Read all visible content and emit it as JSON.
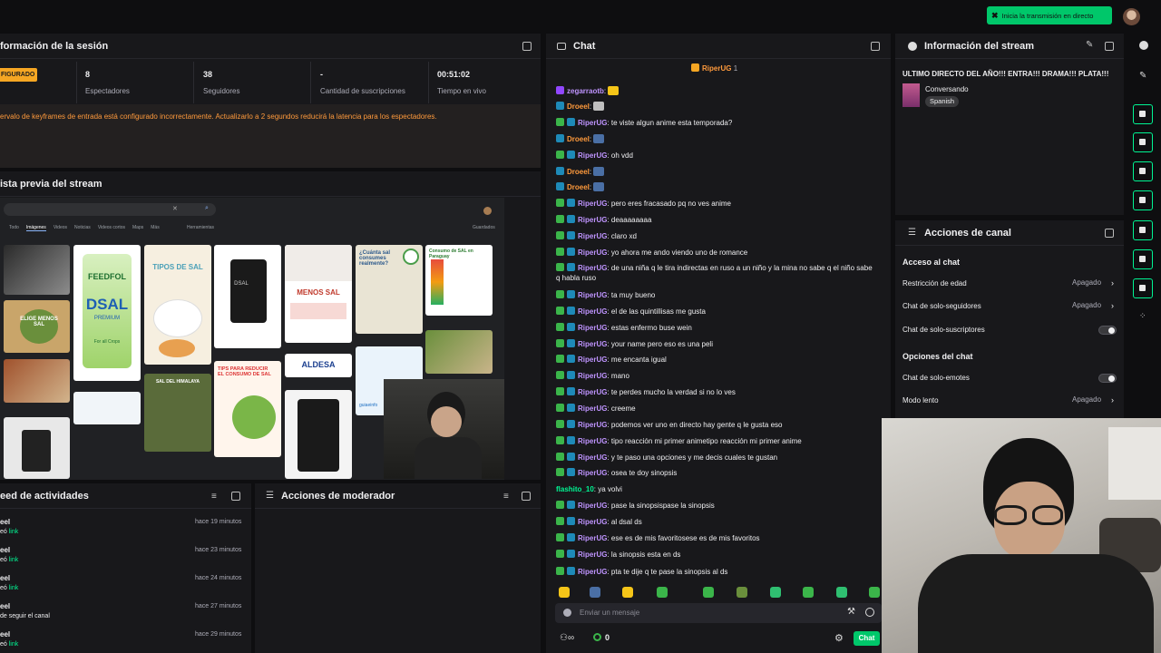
{
  "topbar": {
    "go_live_label": "Inicia la transmisión en directo"
  },
  "session": {
    "title": "formación de la sesión",
    "status_badge": "FIGURADO",
    "stats": [
      {
        "value": "8",
        "label": "Espectadores"
      },
      {
        "value": "38",
        "label": "Seguidores"
      },
      {
        "value": "-",
        "label": "Cantidad de suscripciones"
      },
      {
        "value": "00:51:02",
        "label": "Tiempo en vivo"
      }
    ],
    "warning": "ervalo de keyframes de entrada está configurado incorrectamente. Actualizarlo a 2 segundos reducirá la latencia para los espectadores."
  },
  "preview": {
    "title": "ista previa del stream",
    "tabs": [
      "Todo",
      "Imágenes",
      "Videos",
      "Noticias",
      "Videos cortos",
      "Maps",
      "Más"
    ],
    "tools_label": "Herramientas",
    "saved_label": "Guardados",
    "thumbs": {
      "feedfol": "FEEDFOL",
      "dsal": "DSAL",
      "premium": "PREMIUM",
      "for_all_crops": "For all Crops",
      "tipos_de_sal": "TIPOS DE SAL",
      "menos_sal": "MENOS SAL",
      "elige_menos_sal": "ELIGE MENOS SAL",
      "cuanta_sal": "¿Cuánta sal consumes realmente?",
      "consumo_de_sal": "Consumo de SAL en Paraguay",
      "tips_para_reducir": "TIPS PARA REDUCIR EL CONSUMO DE SAL",
      "aldesa": "ALDESA",
      "sal_del_himalaya": "SAL DEL HIMALAYA",
      "guia_info": "guiaeinfo"
    }
  },
  "activity": {
    "title": "eed de actividades",
    "items": [
      {
        "name": "eel",
        "action": "eó",
        "link": "link",
        "time": "hace 19 minutos"
      },
      {
        "name": "eel",
        "action": "eó",
        "link": "link",
        "time": "hace 23 minutos"
      },
      {
        "name": "eel",
        "action": "eó",
        "link": "link",
        "time": "hace 24 minutos"
      },
      {
        "name": "eel",
        "action": "de seguir el canal",
        "link": "",
        "time": "hace 27 minutos"
      },
      {
        "name": "eel",
        "action": "eó",
        "link": "link",
        "time": "hace 29 minutos"
      }
    ]
  },
  "moderator": {
    "title": "Acciones de moderador"
  },
  "chat": {
    "title": "Chat",
    "pinned_user": "RiperUG",
    "pinned_count": "1",
    "messages": [
      {
        "user": "zegarraotb",
        "color": "#bf94ff",
        "badges": [
          "purple"
        ],
        "text": "",
        "emote": "#f5c518"
      },
      {
        "user": "Droeel",
        "color": "#ff9a3c",
        "badges": [
          "blue"
        ],
        "text": "",
        "emote": "#bfbfbf"
      },
      {
        "user": "RiperUG",
        "color": "#bf94ff",
        "badges": [
          "green",
          "blue"
        ],
        "text": "te viste algun anime esta temporada?"
      },
      {
        "user": "Droeel",
        "color": "#ff9a3c",
        "badges": [
          "blue"
        ],
        "text": "",
        "emote": "#4a6fa5"
      },
      {
        "user": "RiperUG",
        "color": "#bf94ff",
        "badges": [
          "green",
          "blue"
        ],
        "text": "oh vdd"
      },
      {
        "user": "Droeel",
        "color": "#ff9a3c",
        "badges": [
          "blue"
        ],
        "text": "",
        "emote": "#4a6fa5"
      },
      {
        "user": "Droeel",
        "color": "#ff9a3c",
        "badges": [
          "blue"
        ],
        "text": "",
        "emote": "#4a6fa5"
      },
      {
        "user": "RiperUG",
        "color": "#bf94ff",
        "badges": [
          "green",
          "blue"
        ],
        "text": "pero eres fracasado pq no ves anime"
      },
      {
        "user": "RiperUG",
        "color": "#bf94ff",
        "badges": [
          "green",
          "blue"
        ],
        "text": "deaaaaaaaa"
      },
      {
        "user": "RiperUG",
        "color": "#bf94ff",
        "badges": [
          "green",
          "blue"
        ],
        "text": "claro xd"
      },
      {
        "user": "RiperUG",
        "color": "#bf94ff",
        "badges": [
          "green",
          "blue"
        ],
        "text": "yo ahora me ando viendo uno de romance"
      },
      {
        "user": "RiperUG",
        "color": "#bf94ff",
        "badges": [
          "green",
          "blue"
        ],
        "text": "de una niña q le tira indirectas en ruso a un niño y la mina no sabe q el niño sabe q habla ruso",
        "wrap": true
      },
      {
        "user": "RiperUG",
        "color": "#bf94ff",
        "badges": [
          "green",
          "blue"
        ],
        "text": "ta muy bueno"
      },
      {
        "user": "RiperUG",
        "color": "#bf94ff",
        "badges": [
          "green",
          "blue"
        ],
        "text": "el de las quintillisas me gusta"
      },
      {
        "user": "RiperUG",
        "color": "#bf94ff",
        "badges": [
          "green",
          "blue"
        ],
        "text": "estas enfermo buse wein"
      },
      {
        "user": "RiperUG",
        "color": "#bf94ff",
        "badges": [
          "green",
          "blue"
        ],
        "text": "your name pero eso es una peli"
      },
      {
        "user": "RiperUG",
        "color": "#bf94ff",
        "badges": [
          "green",
          "blue"
        ],
        "text": "me encanta igual"
      },
      {
        "user": "RiperUG",
        "color": "#bf94ff",
        "badges": [
          "green",
          "blue"
        ],
        "text": "mano"
      },
      {
        "user": "RiperUG",
        "color": "#bf94ff",
        "badges": [
          "green",
          "blue"
        ],
        "text": "te perdes mucho la verdad si no lo ves"
      },
      {
        "user": "RiperUG",
        "color": "#bf94ff",
        "badges": [
          "green",
          "blue"
        ],
        "text": "creeme"
      },
      {
        "user": "RiperUG",
        "color": "#bf94ff",
        "badges": [
          "green",
          "blue"
        ],
        "text": "podemos ver uno en directo hay gente q le gusta eso"
      },
      {
        "user": "RiperUG",
        "color": "#bf94ff",
        "badges": [
          "green",
          "blue"
        ],
        "text": "tipo reacción mi primer animetipo reacción mi primer anime"
      },
      {
        "user": "RiperUG",
        "color": "#bf94ff",
        "badges": [
          "green",
          "blue"
        ],
        "text": "y te paso una opciones y me decis cuales te gustan"
      },
      {
        "user": "RiperUG",
        "color": "#bf94ff",
        "badges": [
          "green",
          "blue"
        ],
        "text": "osea te doy sinopsis"
      },
      {
        "user": "flashito_10",
        "color": "#00f593",
        "badges": [],
        "text": "ya volvi"
      },
      {
        "user": "RiperUG",
        "color": "#bf94ff",
        "badges": [
          "green",
          "blue"
        ],
        "text": "pase la sinopsispase la sinopsis"
      },
      {
        "user": "RiperUG",
        "color": "#bf94ff",
        "badges": [
          "green",
          "blue"
        ],
        "text": "al dsal ds"
      },
      {
        "user": "RiperUG",
        "color": "#bf94ff",
        "badges": [
          "green",
          "blue"
        ],
        "text": "ese es de mis favoritosese es de mis favoritos"
      },
      {
        "user": "RiperUG",
        "color": "#bf94ff",
        "badges": [
          "green",
          "blue"
        ],
        "text": "la sinopsis esta en ds"
      },
      {
        "user": "RiperUG",
        "color": "#bf94ff",
        "badges": [
          "green",
          "blue"
        ],
        "text": "pta te dije q te pase la sinopsis al ds"
      }
    ],
    "emote_bar": [
      "#f5c518",
      "#4a6fa5",
      "#f5c518",
      "#3bb54a",
      "#3bb54a",
      "#6a8f3c",
      "#2fbf71",
      "#3bb54a",
      "#2fbf71",
      "#3bb54a"
    ],
    "input_placeholder": "Enviar un mensaje",
    "points_value": "0",
    "send_label": "Chat"
  },
  "stream_info": {
    "title": "Información del stream",
    "stream_title": "ULTIMO DIRECTO DEL AÑO!!! ENTRA!!! DRAMA!!! PLATA!!!",
    "category": "Conversando",
    "tag": "Spanish"
  },
  "channel_actions": {
    "title": "Acciones de canal",
    "section_chat_access": "Acceso al chat",
    "age_restriction": {
      "label": "Restricción de edad",
      "value": "Apagado"
    },
    "followers_only": {
      "label": "Chat de solo-seguidores",
      "value": "Apagado"
    },
    "subscribers_only": {
      "label": "Chat de solo-suscriptores"
    },
    "section_chat_options": "Opciones del chat",
    "emotes_only": {
      "label": "Chat de solo-emotes"
    },
    "slow_mode": {
      "label": "Modo lento",
      "value": "Apagado"
    }
  },
  "colors": {
    "accent": "#00f593",
    "panel": "#18181b",
    "bg": "#0e0e10",
    "warning": "#ff9a3c",
    "purple": "#bf94ff"
  }
}
